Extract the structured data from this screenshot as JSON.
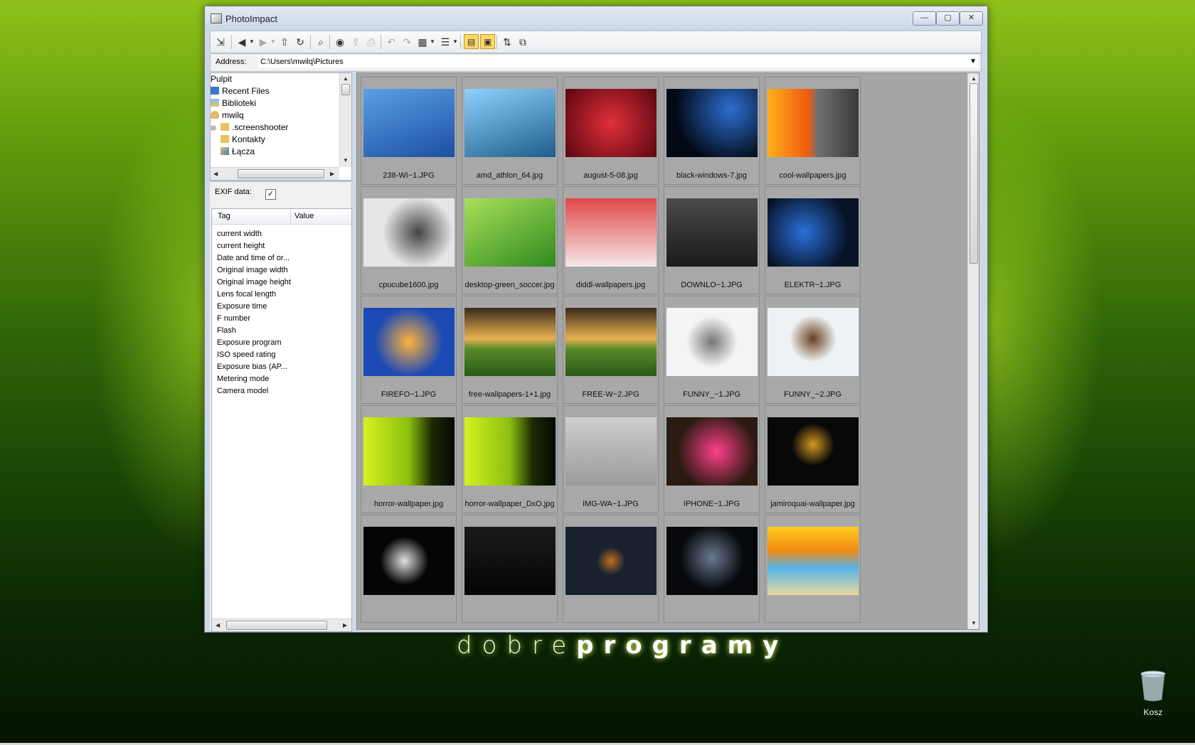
{
  "window": {
    "title": "PhotoImpact",
    "minimize": "—",
    "maximize": "▢",
    "close": "✕"
  },
  "address": {
    "label": "Address:",
    "value": "C:\\Users\\mwilq\\Pictures"
  },
  "tree": {
    "items": [
      {
        "label": "Pulpit"
      },
      {
        "label": "Recent Files"
      },
      {
        "label": "Biblioteki"
      },
      {
        "label": "mwilq"
      },
      {
        "label": ".screenshooter"
      },
      {
        "label": "Kontakty"
      },
      {
        "label": "Łącza"
      }
    ]
  },
  "exif": {
    "label": "EXIF data:",
    "checked": "✓",
    "col_tag": "Tag",
    "col_value": "Value",
    "rows": [
      "current width",
      "current height",
      "Date and time of or...",
      "Original image width",
      "Original image height",
      "Lens focal length",
      "Exposure time",
      "F number",
      "Flash",
      "Exposure program",
      "ISO speed rating",
      "Exposure bias (AP...",
      "Metering mode",
      "Camera model"
    ]
  },
  "thumbnails": [
    {
      "name": "238-WI~1.JPG",
      "bg": "linear-gradient(160deg,#5aa0e8,#1c4fa0)"
    },
    {
      "name": "amd_athlon_64.jpg",
      "bg": "linear-gradient(160deg,#8fd2ff,#1f5d8a)"
    },
    {
      "name": "august-5-08.jpg",
      "bg": "radial-gradient(circle at 50% 50%,#e0303a,#5a0610)"
    },
    {
      "name": "black-windows-7.jpg",
      "bg": "radial-gradient(circle at 70% 30%,#2c6fd0,#020814 70%)"
    },
    {
      "name": "cool-wallpapers.jpg",
      "bg": "linear-gradient(90deg,#ffb01a 0%,#f05a10 45%,#707070 55%,#3a3a3a 100%)"
    },
    {
      "name": "cpucube1600.jpg",
      "bg": "radial-gradient(circle at 60% 50%,#444,#e6e6e6 55%)"
    },
    {
      "name": "desktop-green_soccer.jpg",
      "bg": "linear-gradient(150deg,#a8e05a,#2f8a1e)"
    },
    {
      "name": "diddl-wallpapers.jpg",
      "bg": "linear-gradient(180deg,#e04848,#f7e7e7)"
    },
    {
      "name": "DOWNLO~1.JPG",
      "bg": "linear-gradient(180deg,#4a4a4a,#1a1a1a)"
    },
    {
      "name": "ELEKTR~1.JPG",
      "bg": "radial-gradient(circle at 40% 50%,#2a70d8,#061226 70%)"
    },
    {
      "name": "FIREFO~1.JPG",
      "bg": "radial-gradient(circle at 50% 50%,#ffb23c,#1c4ab4 60%)"
    },
    {
      "name": "free-wallpapers-1+1.jpg",
      "bg": "linear-gradient(180deg,#3a2a1a 0%,#e8b050 45%,#5a8a2a 60%,#2a5a16 100%)"
    },
    {
      "name": "FREE-W~2.JPG",
      "bg": "linear-gradient(180deg,#3a2a1a 0%,#e8b050 45%,#5a8a2a 60%,#2a5a16 100%)"
    },
    {
      "name": "FUNNY_~1.JPG",
      "bg": "radial-gradient(circle at 50% 50%,#777,#f4f4f4 45%)"
    },
    {
      "name": "FUNNY_~2.JPG",
      "bg": "radial-gradient(circle at 50% 45%,#6a4020,#eef2f4 40%)"
    },
    {
      "name": "horror-wallpaper.jpg",
      "bg": "linear-gradient(90deg,#d6f21e 0%,#8bbf10 50%,#1c2a04 75%,#050a02 100%)"
    },
    {
      "name": "horror-wallpaper_DxO.jpg",
      "bg": "linear-gradient(90deg,#d6f21e 0%,#8bbf10 50%,#1c2a04 75%,#050a02 100%)"
    },
    {
      "name": "IMG-WA~1.JPG",
      "bg": "linear-gradient(180deg,#cfcfcf,#9a9a9a)"
    },
    {
      "name": "IPHONE~1.JPG",
      "bg": "radial-gradient(circle at 55% 50%,#ff3f8a,#2a1a10 65%)"
    },
    {
      "name": "jamiroquai-wallpaper.jpg",
      "bg": "radial-gradient(circle at 50% 40%,#d49a20,#080808 35%)"
    },
    {
      "name": "",
      "bg": "radial-gradient(circle at 45% 50%,#e0e0e0,#050505 40%)"
    },
    {
      "name": "",
      "bg": "linear-gradient(180deg,#1a1a1a,#050505)"
    },
    {
      "name": "",
      "bg": "radial-gradient(circle at 50% 50%,#c07020,#1a2230 25%)"
    },
    {
      "name": "",
      "bg": "radial-gradient(circle at 50% 45%,#6a7a90,#06080c 55%)"
    },
    {
      "name": "",
      "bg": "linear-gradient(180deg,#ffcc20 0%,#f08a10 35%,#56b4e8 60%,#e8d8a0 100%)"
    }
  ],
  "branding": {
    "light": "dobre",
    "bold": "programy"
  },
  "desktop": {
    "recycle_bin_label": "Kosz"
  }
}
